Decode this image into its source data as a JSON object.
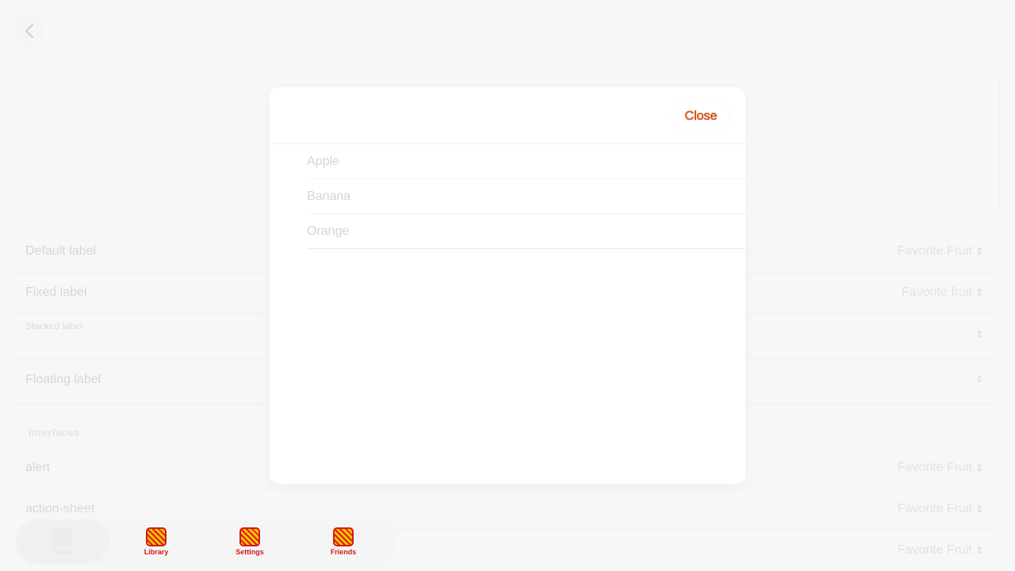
{
  "header": {
    "back_icon": "chevron-left-icon"
  },
  "rows": [
    {
      "label": "Default label",
      "value": "Favorite Fruit"
    },
    {
      "label": "Fixed label",
      "value": "Favorite fruit"
    },
    {
      "label": "Stacked label",
      "value": ""
    },
    {
      "label": "Floating label",
      "value": ""
    }
  ],
  "section": {
    "title": "Interfaces"
  },
  "interface_rows": [
    {
      "label": "alert",
      "value": "Favorite Fruit"
    },
    {
      "label": "action-sheet",
      "value": "Favorite Fruit"
    },
    {
      "label": "",
      "value": "Favorite Fruit"
    }
  ],
  "tabbar": {
    "tabs": [
      {
        "label": "Inbox",
        "icon": "document-icon"
      },
      {
        "label": "Library",
        "icon": "library-icon"
      },
      {
        "label": "Settings",
        "icon": "settings-icon"
      },
      {
        "label": "Friends",
        "icon": "friends-icon"
      }
    ]
  },
  "modal": {
    "close_label": "Close",
    "options": [
      "Apple",
      "Banana",
      "Orange"
    ]
  },
  "colors": {
    "accent_text": "#e0a100",
    "accent_outline": "#c81a1a"
  }
}
